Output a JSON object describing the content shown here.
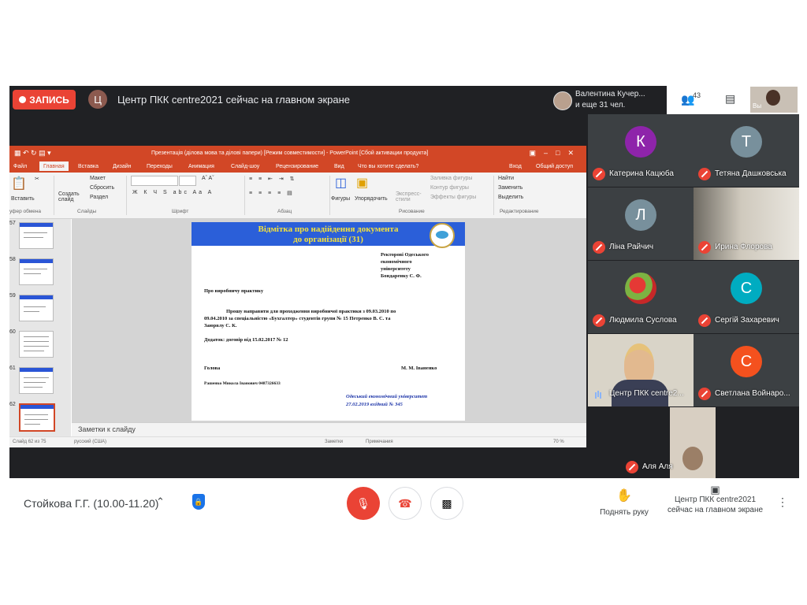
{
  "topbar": {
    "rec_label": "ЗАПИСЬ",
    "presenter_initial": "Ц",
    "presenting_text": "Центр ПКК centre2021 сейчас на главном экране",
    "viewers_line1": "Валентина Кучер...",
    "viewers_line2": "и еще 31 чел.",
    "people_count": "43",
    "self_label": "Вы"
  },
  "ppt": {
    "title": "Презентація (ділова мова та ділові папери) [Режим совместимости] - PowerPoint [Сбой активации продукта]",
    "tabs": [
      "Файл",
      "Главная",
      "Вставка",
      "Дизайн",
      "Переходы",
      "Анимация",
      "Слайд-шоу",
      "Рецензирование",
      "Вид",
      "Что вы хотите сделать?",
      "Вход",
      "Общий доступ"
    ],
    "ribbon": {
      "paste": "Вставить",
      "create": "Создать слайд",
      "layout": "Макет",
      "reset": "Сбросить",
      "section": "Раздел",
      "shapes": "Фигуры",
      "arrange": "Упорядочить",
      "styles": "Экспресс-стили",
      "fill": "Заливка фигуры",
      "outline": "Контур фигуры",
      "effects": "Эффекты фигуры",
      "find": "Найти",
      "replace": "Заменить",
      "select": "Выделить",
      "groups": [
        "уфер обмена",
        "Слайды",
        "Шрифт",
        "Абзац",
        "Рисование",
        "Редактирование"
      ]
    },
    "thumb_numbers": [
      "57",
      "58",
      "59",
      "60",
      "61",
      "62"
    ],
    "slide": {
      "header1": "Відмітка про надійдення документа",
      "header2": "до організації (31)",
      "addressee": [
        "Ректорові Одеського",
        "економічного",
        "університету",
        "Бондаренку С. Ф."
      ],
      "subject": "Про виробничу практику",
      "body1": "Прошу направити для проходження виробничої практики з 09.03.2010 по",
      "body2": "09.04.2010 за спеціальністю «Бухгалтер» студентів групи № 15 Петренко В. С. та",
      "body3": "Заюрвлу С. К.",
      "attachment": "Додаток: договір від 15.02.2017 № 12",
      "signer_left": "Голова",
      "signer_right": "М. М. Іваненко",
      "contact": "Рашенко Микола Іванович 0487326633",
      "stamp1": "Одеський економічний університет",
      "stamp2": "27.02.2019 вхідний № 345"
    },
    "notes": "Заметки к слайду",
    "status_left": "Слайд 62 из 75",
    "status_lang": "русский (США)",
    "status_notes": "Заметки",
    "status_comments": "Примечания",
    "status_zoom": "70 %"
  },
  "participants": [
    {
      "initial": "К",
      "name": "Катерина Кацюба",
      "color": "#8e24aa"
    },
    {
      "initial": "Т",
      "name": "Тетяна Дашковська",
      "color": "#78909c"
    },
    {
      "initial": "Л",
      "name": "Ліна Райчич",
      "color": "#78909c"
    },
    {
      "initial": "",
      "name": "Ирина Флорова",
      "color": ""
    },
    {
      "initial": "",
      "name": "Людмила Суслова",
      "color": ""
    },
    {
      "initial": "С",
      "name": "Сергій Захаревич",
      "color": "#00acc1"
    },
    {
      "initial": "",
      "name": "Центр ПКК centre2...",
      "color": ""
    },
    {
      "initial": "С",
      "name": "Светлана Войнаро...",
      "color": "#f4511e"
    },
    {
      "initial": "",
      "name": "Аля Аля",
      "color": ""
    }
  ],
  "bottom": {
    "meeting_title": "Стойкова Г.Г. (10.00-11.20)",
    "raise_hand": "Поднять руку",
    "presenting_line1": "Центр ПКК centre2021",
    "presenting_line2": "сейчас на главном экране"
  }
}
